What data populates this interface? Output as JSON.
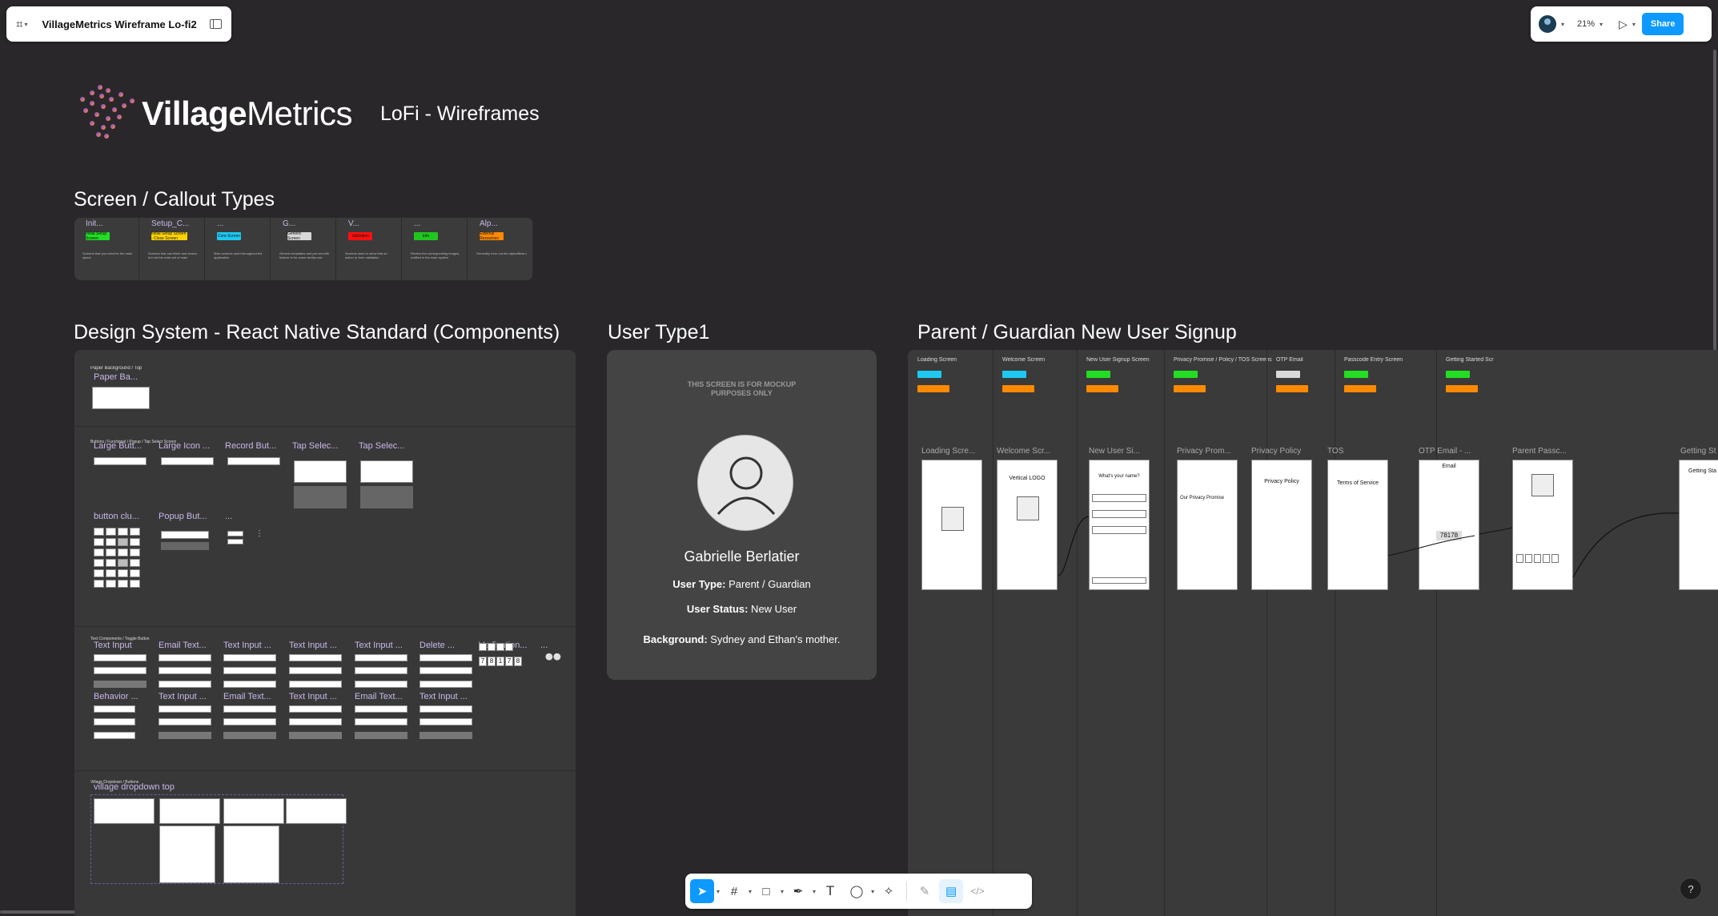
{
  "file": {
    "title": "VillageMetrics Wireframe Lo-fi2"
  },
  "right_toolbar": {
    "zoom": "21%",
    "share_label": "Share"
  },
  "canvas": {
    "logo_bold": "Village",
    "logo_light": "Metrics",
    "subtitle": "LoFi - Wireframes",
    "callout": {
      "title": "Screen / Callout Types",
      "cols": [
        {
          "name": "Init...",
          "tag": "Initial Setup Screen",
          "color": "#22dd22",
          "desc": "Screens that you need for the main space"
        },
        {
          "name": "Setup_C...",
          "tag": "Initial Setup Screen - Close Screen",
          "color": "#ffd400",
          "desc": "Screens that can finish and closes, but not the main set of main screens"
        },
        {
          "name": "...",
          "tag": "Core Screen",
          "color": "#1ec8f2",
          "desc": "Main screens used throughout the application"
        },
        {
          "name": "G...",
          "tag": "Generic Screen",
          "color": "#d8d8d8",
          "desc": "Generic templates and pre-set with feature in for some similar use"
        },
        {
          "name": "V...",
          "tag": "Validation",
          "color": "#ff1010",
          "desc": "Screens used to show that an action or form validation"
        },
        {
          "name": "...",
          "tag": "Info",
          "color": "#1fc61f",
          "desc": "Review the corresponding images, notified in the main system"
        },
        {
          "name": "Alp...",
          "tag": "External Resources",
          "color": "#ff8a00",
          "desc": "Generally from out the alpha/Beta v"
        }
      ]
    },
    "design_system": {
      "title": "Design System - React Native Standard (Components)",
      "row1": {
        "section": "Paper Background / Top",
        "items": [
          "Paper Ba..."
        ]
      },
      "row2": {
        "section": "Buttons / Functional / Popup / Tap Select Screen",
        "items": [
          "Large Butt...",
          "Large Icon ...",
          "Record But...",
          "Tap Selec...",
          "Tap Selec...",
          "button clu...",
          "Popup But...",
          "..."
        ]
      },
      "row3": {
        "section": "Text Components / Toggle Button",
        "items": [
          "Text Input",
          "Email Text...",
          "Text Input ...",
          "Text Input ...",
          "Text Input ...",
          "Delete ...",
          "Verfication...",
          "...",
          "Behavior ...",
          "Text Input ...",
          "Email Text...",
          "Text Input ...",
          "Email Text...",
          "Text Input ..."
        ],
        "code": [
          "7",
          "8",
          "1",
          "7",
          "8"
        ]
      },
      "row4": {
        "section": "Village Dropdown / Buttons",
        "items": [
          "village dropdown top"
        ]
      }
    },
    "user_type": {
      "title": "User Type1",
      "mockup_note": "THIS SCREEN IS FOR MOCKUP PURPOSES ONLY",
      "name": "Gabrielle Berlatier",
      "type_label": "User Type:",
      "type_value": " Parent / Guardian",
      "status_label": "User Status:",
      "status_value": " New User",
      "bg_label": "Background:",
      "bg_value": " Sydney and Ethan's mother."
    },
    "signup": {
      "title": "Parent / Guardian New User Signup",
      "columns": [
        "Loading Screen",
        "Welcome Screen",
        "New User Signup Screen",
        "Privacy Promise / Policy / TOS Screens",
        "OTP Email",
        "Passcode Entry Screen",
        "Getting Started Scr"
      ],
      "frames": [
        "Loading Scre...",
        "Welcome Scr...",
        "New User Si...",
        "Privacy Prom...",
        "Privacy Policy",
        "TOS",
        "OTP Email - ...",
        "Parent Passc...",
        "Getting St"
      ],
      "welcome_logo": "Vertical LOGO",
      "name_q": "What's your name?",
      "promise_title": "Our Privacy Promise",
      "policy_title": "Privacy Policy",
      "tos_title": "Terms of Service",
      "otp_title": "Email",
      "otp_code": "78178",
      "getting_started": "Getting Sta"
    }
  },
  "colors": {
    "canvas": "#2a272b",
    "accent": "#0d99ff",
    "brand": "#e0407a"
  }
}
